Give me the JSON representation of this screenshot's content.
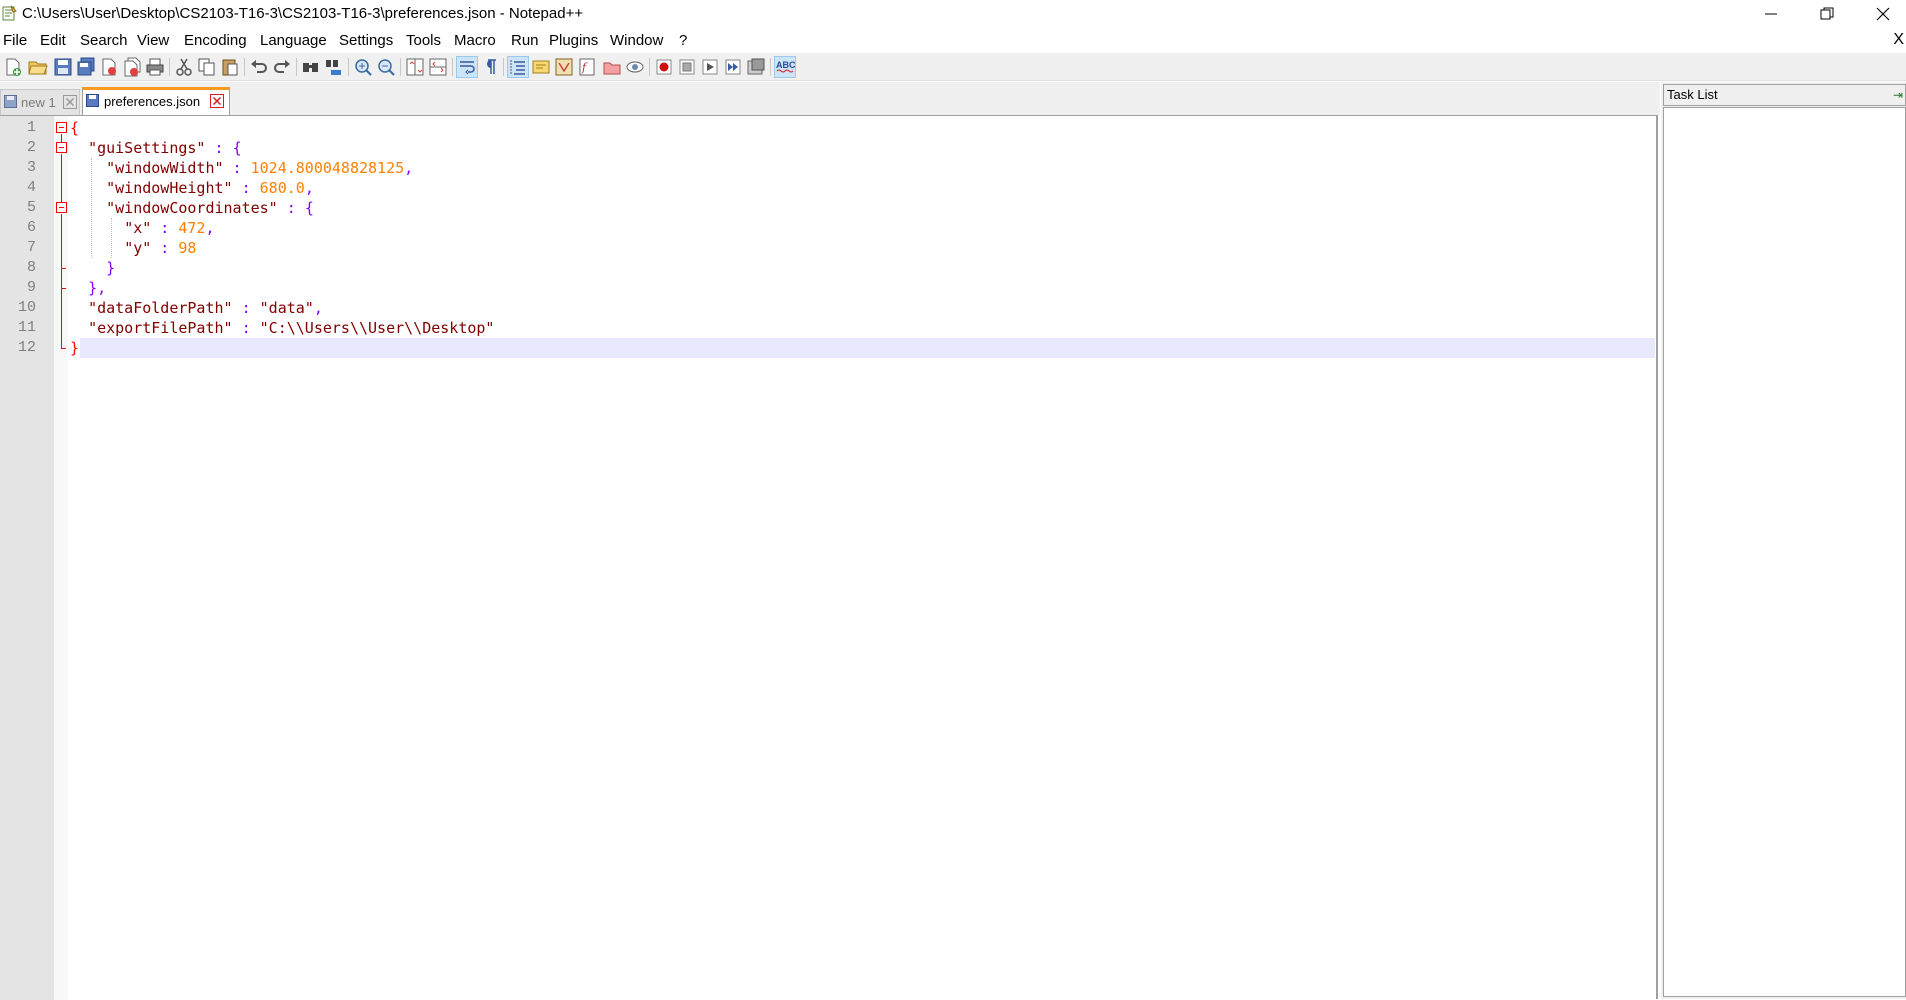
{
  "window": {
    "title": "C:\\Users\\User\\Desktop\\CS2103-T16-3\\CS2103-T16-3\\preferences.json - Notepad++",
    "minimize_glyph": "—",
    "restore_glyph": "❐",
    "close_glyph": "✕"
  },
  "menu": {
    "items": [
      "File",
      "Edit",
      "Search",
      "View",
      "Encoding",
      "Language",
      "Settings",
      "Tools",
      "Macro",
      "Run",
      "Plugins",
      "Window",
      "?"
    ],
    "close_doc": "X"
  },
  "toolbar": {
    "icons": [
      "new-file-icon",
      "open-file-icon",
      "save-icon",
      "save-all-icon",
      "close-icon",
      "close-all-icon",
      "print-icon",
      "cut-icon",
      "copy-icon",
      "paste-icon",
      "undo-icon",
      "redo-icon",
      "find-icon",
      "replace-icon",
      "zoom-in-icon",
      "zoom-out-icon",
      "sync-vertical-icon",
      "sync-horizontal-icon",
      "word-wrap-icon",
      "show-all-chars-icon",
      "indent-guide-icon",
      "user-language-icon",
      "doc-map-icon",
      "function-list-icon",
      "folder-as-workspace-icon",
      "monitoring-icon",
      "record-macro-icon",
      "stop-record-icon",
      "playback-macro-icon",
      "run-macro-multiple-icon",
      "save-macro-icon",
      "spell-check-icon"
    ]
  },
  "tabs": [
    {
      "label": "new 1",
      "active": false
    },
    {
      "label": "preferences.json",
      "active": true
    }
  ],
  "editor": {
    "line_numbers": [
      "1",
      "2",
      "3",
      "4",
      "5",
      "6",
      "7",
      "8",
      "9",
      "10",
      "11",
      "12"
    ],
    "lines": [
      {
        "tokens": [
          [
            "brace-red",
            "{"
          ]
        ]
      },
      {
        "tokens": [
          [
            "plain",
            "  "
          ],
          [
            "key",
            "\"guiSettings\""
          ],
          [
            "punc",
            " : "
          ],
          [
            "brace",
            "{"
          ]
        ]
      },
      {
        "tokens": [
          [
            "plain",
            "    "
          ],
          [
            "key",
            "\"windowWidth\""
          ],
          [
            "punc",
            " : "
          ],
          [
            "num",
            "1024.800048828125"
          ],
          [
            "punc",
            ","
          ]
        ]
      },
      {
        "tokens": [
          [
            "plain",
            "    "
          ],
          [
            "key",
            "\"windowHeight\""
          ],
          [
            "punc",
            " : "
          ],
          [
            "num",
            "680.0"
          ],
          [
            "punc",
            ","
          ]
        ]
      },
      {
        "tokens": [
          [
            "plain",
            "    "
          ],
          [
            "key",
            "\"windowCoordinates\""
          ],
          [
            "punc",
            " : "
          ],
          [
            "brace",
            "{"
          ]
        ]
      },
      {
        "tokens": [
          [
            "plain",
            "      "
          ],
          [
            "key",
            "\"x\""
          ],
          [
            "punc",
            " : "
          ],
          [
            "num",
            "472"
          ],
          [
            "punc",
            ","
          ]
        ]
      },
      {
        "tokens": [
          [
            "plain",
            "      "
          ],
          [
            "key",
            "\"y\""
          ],
          [
            "punc",
            " : "
          ],
          [
            "num",
            "98"
          ]
        ]
      },
      {
        "tokens": [
          [
            "plain",
            "    "
          ],
          [
            "brace",
            "}"
          ]
        ]
      },
      {
        "tokens": [
          [
            "plain",
            "  "
          ],
          [
            "brace",
            "}"
          ],
          [
            "punc",
            ","
          ]
        ]
      },
      {
        "tokens": [
          [
            "plain",
            "  "
          ],
          [
            "key",
            "\"dataFolderPath\""
          ],
          [
            "punc",
            " : "
          ],
          [
            "str",
            "\"data\""
          ],
          [
            "punc",
            ","
          ]
        ]
      },
      {
        "tokens": [
          [
            "plain",
            "  "
          ],
          [
            "key",
            "\"exportFilePath\""
          ],
          [
            "punc",
            " : "
          ],
          [
            "str",
            "\"C:\\\\Users\\\\User\\\\Desktop\""
          ]
        ]
      },
      {
        "tokens": [
          [
            "brace-red",
            "}"
          ]
        ]
      }
    ],
    "current_line": 12
  },
  "tasklist": {
    "title": "Task List",
    "pin_glyph": "⇥"
  },
  "colors": {
    "key": "#800000",
    "number": "#ff8000",
    "operator": "#8000ff",
    "brace_match": "#ff0000",
    "caret_line": "#e8e8ff",
    "active_tab_accent": "#fa9b20"
  }
}
